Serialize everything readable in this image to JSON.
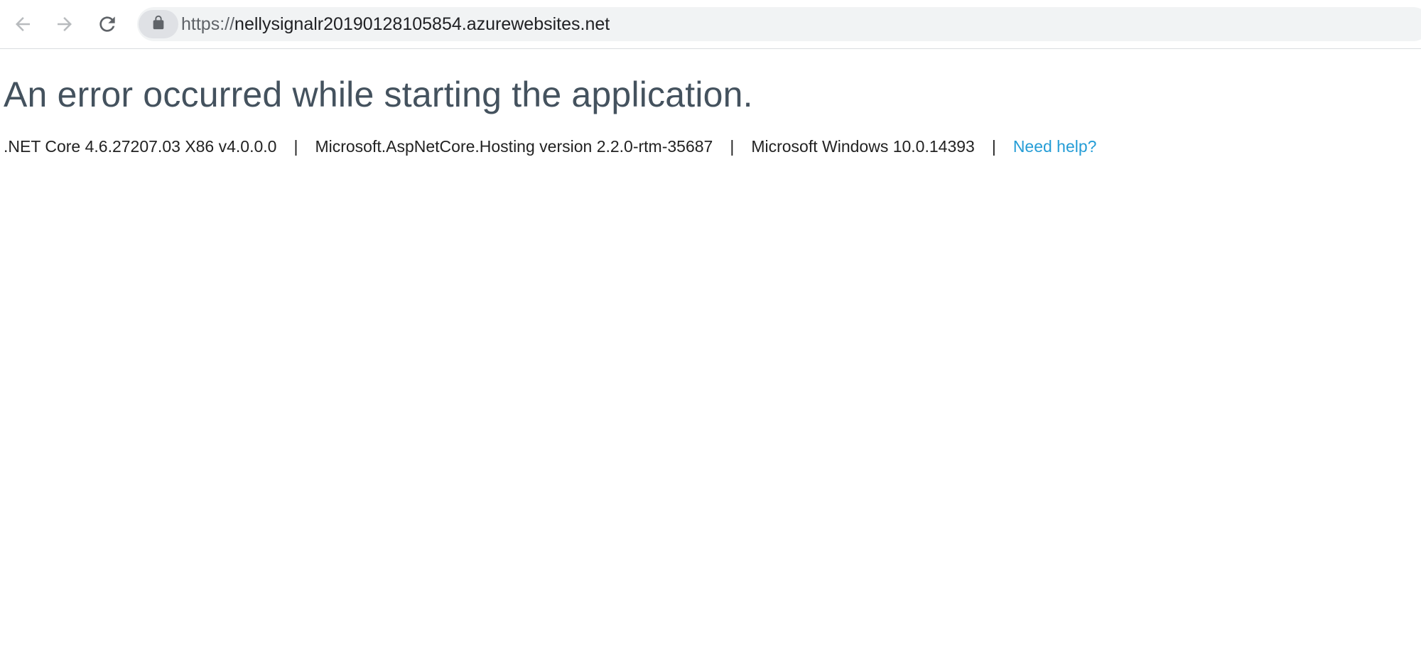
{
  "browser": {
    "url_scheme": "https://",
    "url_host": "nellysignalr20190128105854.azurewebsites.net",
    "icons": {
      "back": "back-arrow-icon",
      "forward": "forward-arrow-icon",
      "reload": "reload-icon",
      "lock": "lock-icon"
    }
  },
  "page": {
    "heading": "An error occurred while starting the application.",
    "footer": {
      "runtime": ".NET Core 4.6.27207.03 X86 v4.0.0.0",
      "hosting": "Microsoft.AspNetCore.Hosting version 2.2.0-rtm-35687",
      "os": "Microsoft Windows 10.0.14393",
      "separator": "|",
      "help_link": "Need help?"
    }
  },
  "colors": {
    "heading": "#44525e",
    "link": "#259dd6",
    "omnibox_bg": "#f1f3f4"
  }
}
